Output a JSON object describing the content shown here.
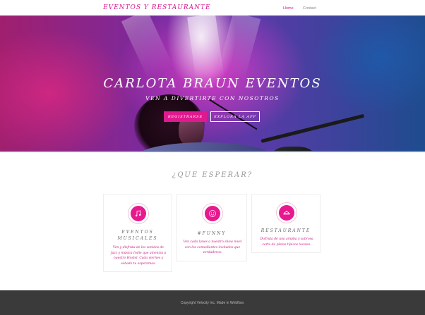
{
  "nav": {
    "brand": "EVENTOS Y RESTAURANTE",
    "links": [
      "Home",
      "Contact"
    ]
  },
  "hero": {
    "title": "CARLOTA BRAUN EVENTOS",
    "subtitle": "VEN A DIVERTIRTE CON NOSOTROS",
    "primary_button": "REGISTRARSE",
    "secondary_button": "EXPLORA LA APP"
  },
  "section": {
    "title": "¿QUE ESPERAR?"
  },
  "cards": [
    {
      "icon": "music-note-icon",
      "title_line1": "EVENTOS",
      "title_line2": "MUSICALES",
      "text": "Ven y disfruta de los sonidos de Jazz y música Indie que ameniza a nuestro Hostel. Cada viernes y sábado te esperamos."
    },
    {
      "icon": "smile-face-icon",
      "title": "#FUNNY",
      "text": "Ven cada lunes a nuestro show nivel con los comediantes invitados que verdaderos."
    },
    {
      "icon": "dish-icon",
      "title": "RESTAURANTE",
      "text": "Disfruta de una amplia y sabrosa carta de platos típicos locales."
    }
  ],
  "footer": {
    "text": "Copyright Velocity Inc. Made in Webflow."
  },
  "colors": {
    "accent": "#e0198f",
    "footer_bg": "#3a3a3a",
    "hero_border": "#4ea0e8"
  }
}
